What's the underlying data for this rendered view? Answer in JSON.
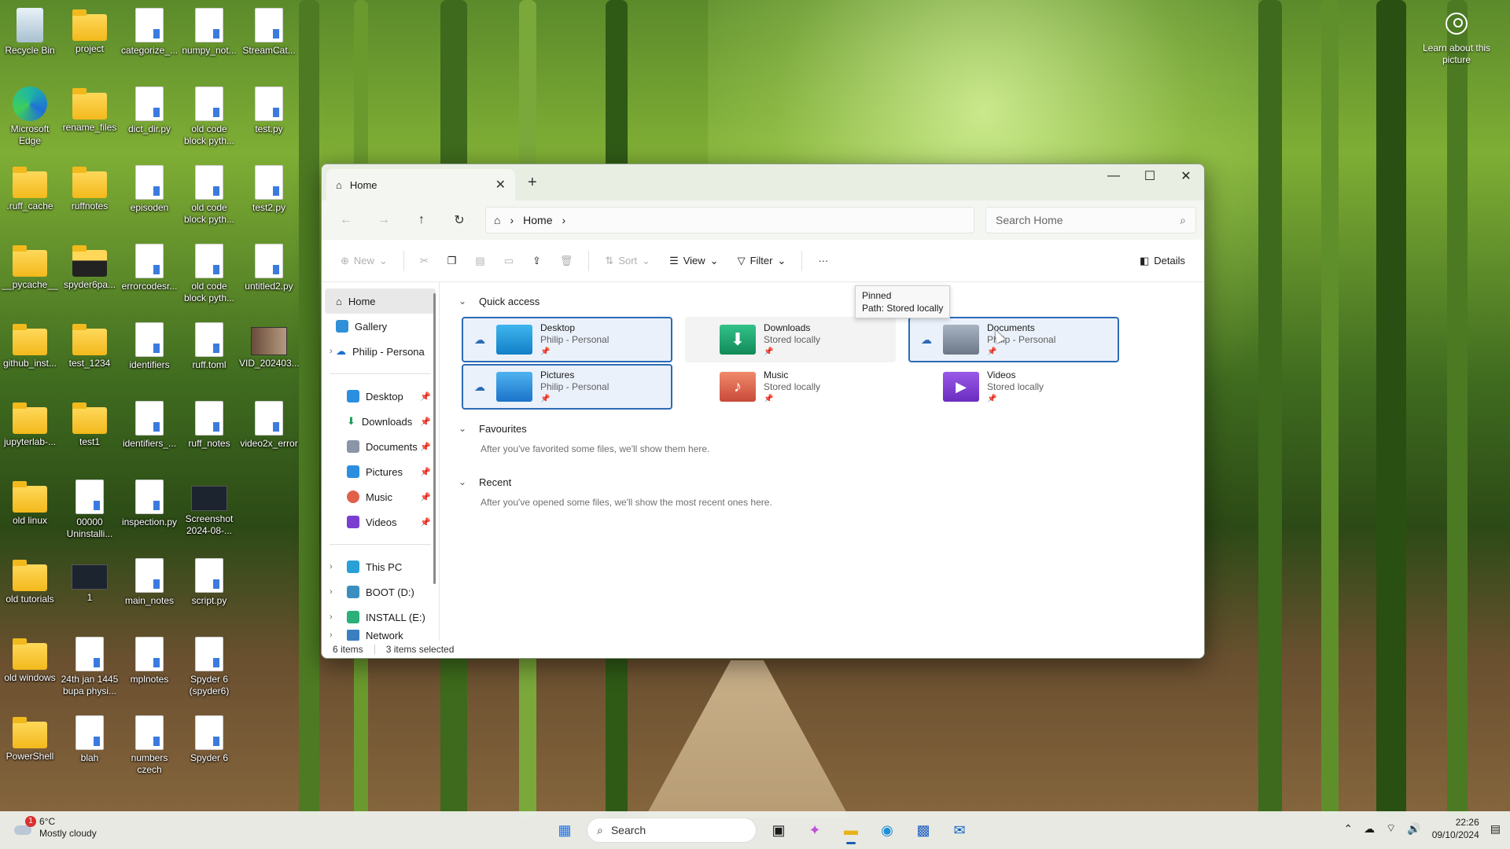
{
  "desktop": {
    "icons": [
      {
        "label": "Recycle Bin"
      },
      {
        "label": "project"
      },
      {
        "label": "categorize_..."
      },
      {
        "label": "numpy_not..."
      },
      {
        "label": "StreamCat..."
      },
      {
        "label": "Microsoft Edge"
      },
      {
        "label": "rename_files"
      },
      {
        "label": "dict_dir.py"
      },
      {
        "label": "old code block pyth..."
      },
      {
        "label": "test.py"
      },
      {
        "label": ".ruff_cache"
      },
      {
        "label": "ruffnotes"
      },
      {
        "label": "episoden"
      },
      {
        "label": "old code block pyth..."
      },
      {
        "label": "test2.py"
      },
      {
        "label": "__pycache__"
      },
      {
        "label": "spyder6pa..."
      },
      {
        "label": "errorcodesr..."
      },
      {
        "label": "old code block pyth..."
      },
      {
        "label": "untitled2.py"
      },
      {
        "label": "github_inst..."
      },
      {
        "label": "test_1234"
      },
      {
        "label": "identifiers"
      },
      {
        "label": "ruff.toml"
      },
      {
        "label": "VID_202403..."
      },
      {
        "label": "jupyterlab-..."
      },
      {
        "label": "test1"
      },
      {
        "label": "identifiers_..."
      },
      {
        "label": "ruff_notes"
      },
      {
        "label": "video2x_error"
      },
      {
        "label": "old linux"
      },
      {
        "label": "00000 Uninstalli..."
      },
      {
        "label": "inspection.py"
      },
      {
        "label": "Screenshot 2024-08-..."
      },
      {
        "label": "old tutorials"
      },
      {
        "label": "1"
      },
      {
        "label": "main_notes"
      },
      {
        "label": "script.py"
      },
      {
        "label": "old windows"
      },
      {
        "label": "24th jan 1445 bupa physi..."
      },
      {
        "label": "mplnotes"
      },
      {
        "label": "Spyder 6 (spyder6)"
      },
      {
        "label": "PowerShell"
      },
      {
        "label": "blah"
      },
      {
        "label": "numbers czech"
      },
      {
        "label": "Spyder 6"
      }
    ],
    "learn_about": "Learn about this picture"
  },
  "window": {
    "tab_title": "Home",
    "new_tab": "+",
    "nav": {
      "home_crumb": "Home",
      "search_placeholder": "Search Home"
    },
    "toolbar": {
      "new": "New",
      "sort": "Sort",
      "view": "View",
      "filter": "Filter",
      "more": "···",
      "details": "Details"
    },
    "sidebar": {
      "top": [
        {
          "label": "Home"
        },
        {
          "label": "Gallery"
        },
        {
          "label": "Philip - Persona"
        }
      ],
      "pinned": [
        {
          "label": "Desktop"
        },
        {
          "label": "Downloads"
        },
        {
          "label": "Documents"
        },
        {
          "label": "Pictures"
        },
        {
          "label": "Music"
        },
        {
          "label": "Videos"
        }
      ],
      "drives": [
        {
          "label": "This PC"
        },
        {
          "label": "BOOT (D:)"
        },
        {
          "label": "INSTALL (E:)"
        },
        {
          "label": "Network"
        }
      ]
    },
    "quick_access": {
      "title": "Quick access",
      "items": [
        {
          "name": "Desktop",
          "sub": "Philip - Personal"
        },
        {
          "name": "Downloads",
          "sub": "Stored locally"
        },
        {
          "name": "Documents",
          "sub": "Philip - Personal"
        },
        {
          "name": "Pictures",
          "sub": "Philip - Personal"
        },
        {
          "name": "Music",
          "sub": "Stored locally"
        },
        {
          "name": "Videos",
          "sub": "Stored locally"
        }
      ]
    },
    "tooltip": {
      "line1": "Pinned",
      "line2": "Path: Stored locally"
    },
    "favourites": {
      "title": "Favourites",
      "hint": "After you've favorited some files, we'll show them here."
    },
    "recent": {
      "title": "Recent",
      "hint": "After you've opened some files, we'll show the most recent ones here."
    },
    "status": {
      "items": "6 items",
      "selected": "3 items selected"
    }
  },
  "taskbar": {
    "weather": {
      "temp": "6°C",
      "desc": "Mostly cloudy",
      "badge": "1"
    },
    "search_label": "Search",
    "time": "22:26",
    "date": "09/10/2024"
  },
  "colors": {
    "accent": "#2d6bb5",
    "selection_bg": "#eaf1fb"
  }
}
